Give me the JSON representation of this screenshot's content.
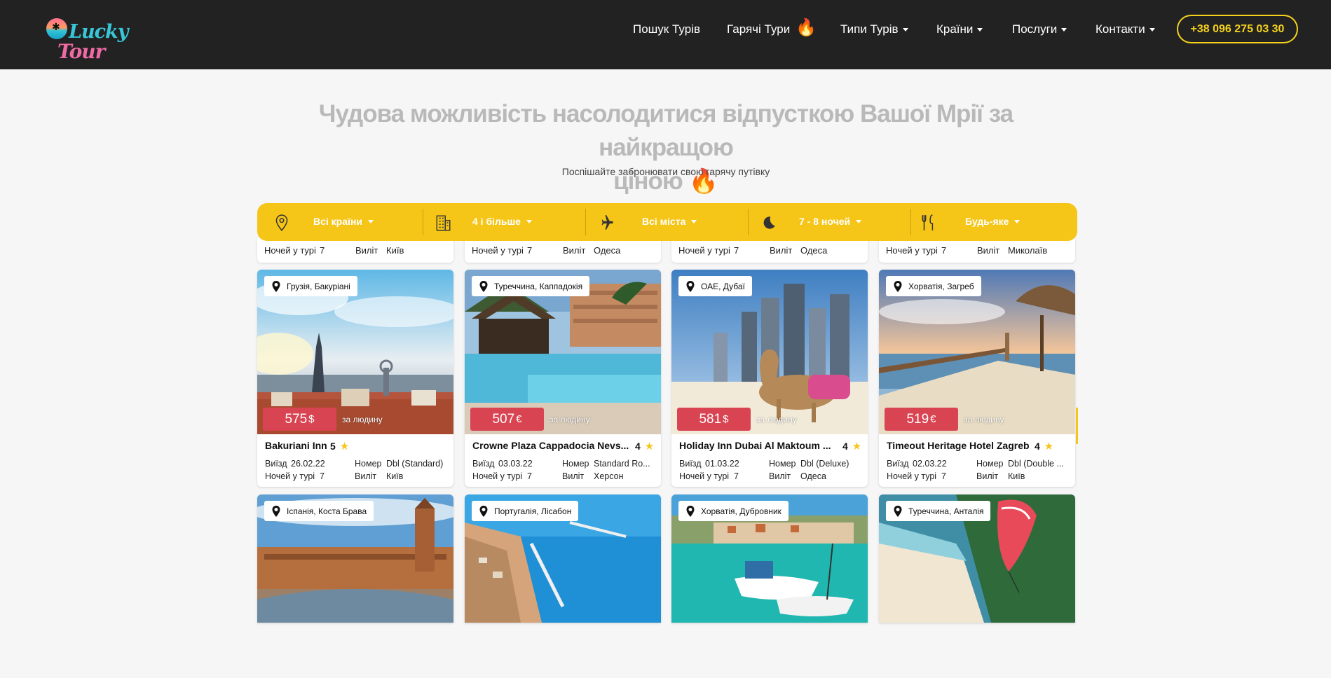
{
  "header": {
    "logo_word1": "Lucky",
    "logo_word2": "Tour",
    "nav": [
      {
        "label": "Пошук Турів",
        "dropdown": false
      },
      {
        "label": "Гарячі Тури",
        "dropdown": false,
        "flame": "🔥"
      },
      {
        "label": "Типи Турів",
        "dropdown": true
      },
      {
        "label": "Країни",
        "dropdown": true
      },
      {
        "label": "Послуги",
        "dropdown": true
      },
      {
        "label": "Контакти",
        "dropdown": true
      }
    ],
    "phone": "+38 096 275 03 30"
  },
  "hero": {
    "title_line1": "Чудова можливість насолодитися відпусткою Вашої Мрії за найкращою",
    "title_line2": "ціною",
    "title_flame": "🔥",
    "subtitle": "Поспішайте забронювати свою гарячу путівку"
  },
  "filters": [
    {
      "icon": "map-pin-icon",
      "label": "Всі країни"
    },
    {
      "icon": "hotel-building-icon",
      "label": "4 і більше"
    },
    {
      "icon": "airplane-icon",
      "label": "Всі міста"
    },
    {
      "icon": "moon-icon",
      "label": "7 - 8 ночей"
    },
    {
      "icon": "cutlery-icon",
      "label": "Будь-яке"
    }
  ],
  "partial_row": [
    {
      "nights_label": "Ночей у турі",
      "nights": "7",
      "depart_label": "Виліт",
      "depart": "Київ"
    },
    {
      "nights_label": "Ночей у турі",
      "nights": "7",
      "depart_label": "Виліт",
      "depart": "Одеса"
    },
    {
      "nights_label": "Ночей у турі",
      "nights": "7",
      "depart_label": "Виліт",
      "depart": "Одеса"
    },
    {
      "nights_label": "Ночей у турі",
      "nights": "7",
      "depart_label": "Виліт",
      "depart": "Миколаїв"
    }
  ],
  "cards": [
    {
      "location": "Грузія, Бакуріані",
      "price": "575",
      "currency": "$",
      "per": "за людину",
      "hotel": "Bakuriani Inn",
      "stars": "5",
      "date_label": "Виїзд",
      "date": "26.02.22",
      "room_label": "Номер",
      "room": "Dbl (Standard)",
      "nights_label": "Ночей у турі",
      "nights": "7",
      "depart_label": "Виліт",
      "depart": "Київ",
      "scene": "georgia"
    },
    {
      "location": "Туреччина, Каппадокія",
      "price": "507",
      "currency": "€",
      "per": "за людину",
      "hotel": "Crowne Plaza Cappadocia Nevs...",
      "stars": "4",
      "date_label": "Виїзд",
      "date": "03.03.22",
      "room_label": "Номер",
      "room": "Standard Ro...",
      "nights_label": "Ночей у турі",
      "nights": "7",
      "depart_label": "Виліт",
      "depart": "Херсон",
      "scene": "pool"
    },
    {
      "location": "ОАЕ, Дубаї",
      "price": "581",
      "currency": "$",
      "per": "за людину",
      "hotel": "Holiday Inn Dubai Al Maktoum ...",
      "stars": "4",
      "date_label": "Виїзд",
      "date": "01.03.22",
      "room_label": "Номер",
      "room": "Dbl (Deluxe)",
      "nights_label": "Ночей у турі",
      "nights": "7",
      "depart_label": "Виліт",
      "depart": "Одеса",
      "scene": "dubai"
    },
    {
      "location": "Хорватія, Загреб",
      "price": "519",
      "currency": "€",
      "per": "за людину",
      "hotel": "Timeout Heritage Hotel Zagreb",
      "stars": "4",
      "date_label": "Виїзд",
      "date": "02.03.22",
      "room_label": "Номер",
      "room": "Dbl (Double ...",
      "nights_label": "Ночей у турі",
      "nights": "7",
      "depart_label": "Виліт",
      "depart": "Київ",
      "scene": "pier"
    }
  ],
  "bottom_cards": [
    {
      "location": "Іспанія, Коста Брава",
      "scene": "spain"
    },
    {
      "location": "Португалія, Лісабон",
      "scene": "coast"
    },
    {
      "location": "Хорватія, Дубровник",
      "scene": "boats"
    },
    {
      "location": "Туреччина, Анталія",
      "scene": "beach"
    }
  ]
}
